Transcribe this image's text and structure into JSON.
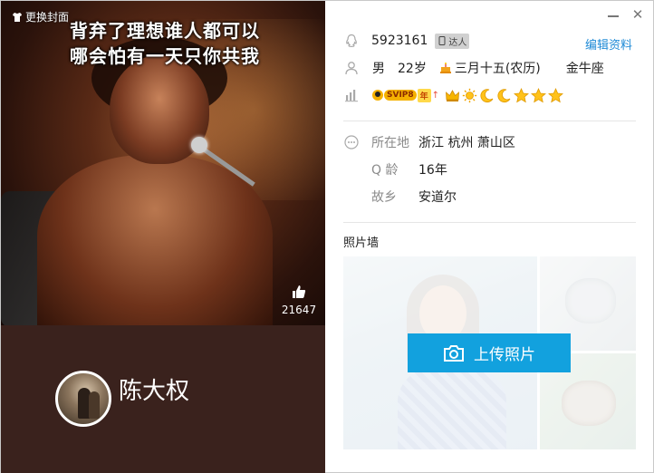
{
  "cover": {
    "change_cover_label": "更换封面",
    "lines": [
      "背弃了理想谁人都可以",
      "哪会怕有一天只你共我"
    ],
    "like_count": "21647"
  },
  "profile": {
    "nickname": "陈大权",
    "qq_number": "5923161",
    "qq_badge": "达人",
    "edit_label": "编辑资料",
    "gender": "男",
    "age": "22岁",
    "birthday": "三月十五(农历)",
    "zodiac": "金牛座",
    "vip_label": "SVIP8",
    "vip_year": "年",
    "level_icons": [
      "crown-icon",
      "sun-icon",
      "moon-icon",
      "moon-icon",
      "star-icon",
      "star-icon",
      "star-icon"
    ]
  },
  "details": {
    "location_label": "所在地",
    "location_value": "浙江 杭州 萧山区",
    "qage_label": "Q 龄",
    "qage_value": "16年",
    "hometown_label": "故乡",
    "hometown_value": "安道尔"
  },
  "photo_wall": {
    "title": "照片墙",
    "upload_label": "上传照片"
  },
  "colors": {
    "accent": "#12a1de",
    "link": "#1f8ad6",
    "panel_bg": "#3a221d"
  }
}
